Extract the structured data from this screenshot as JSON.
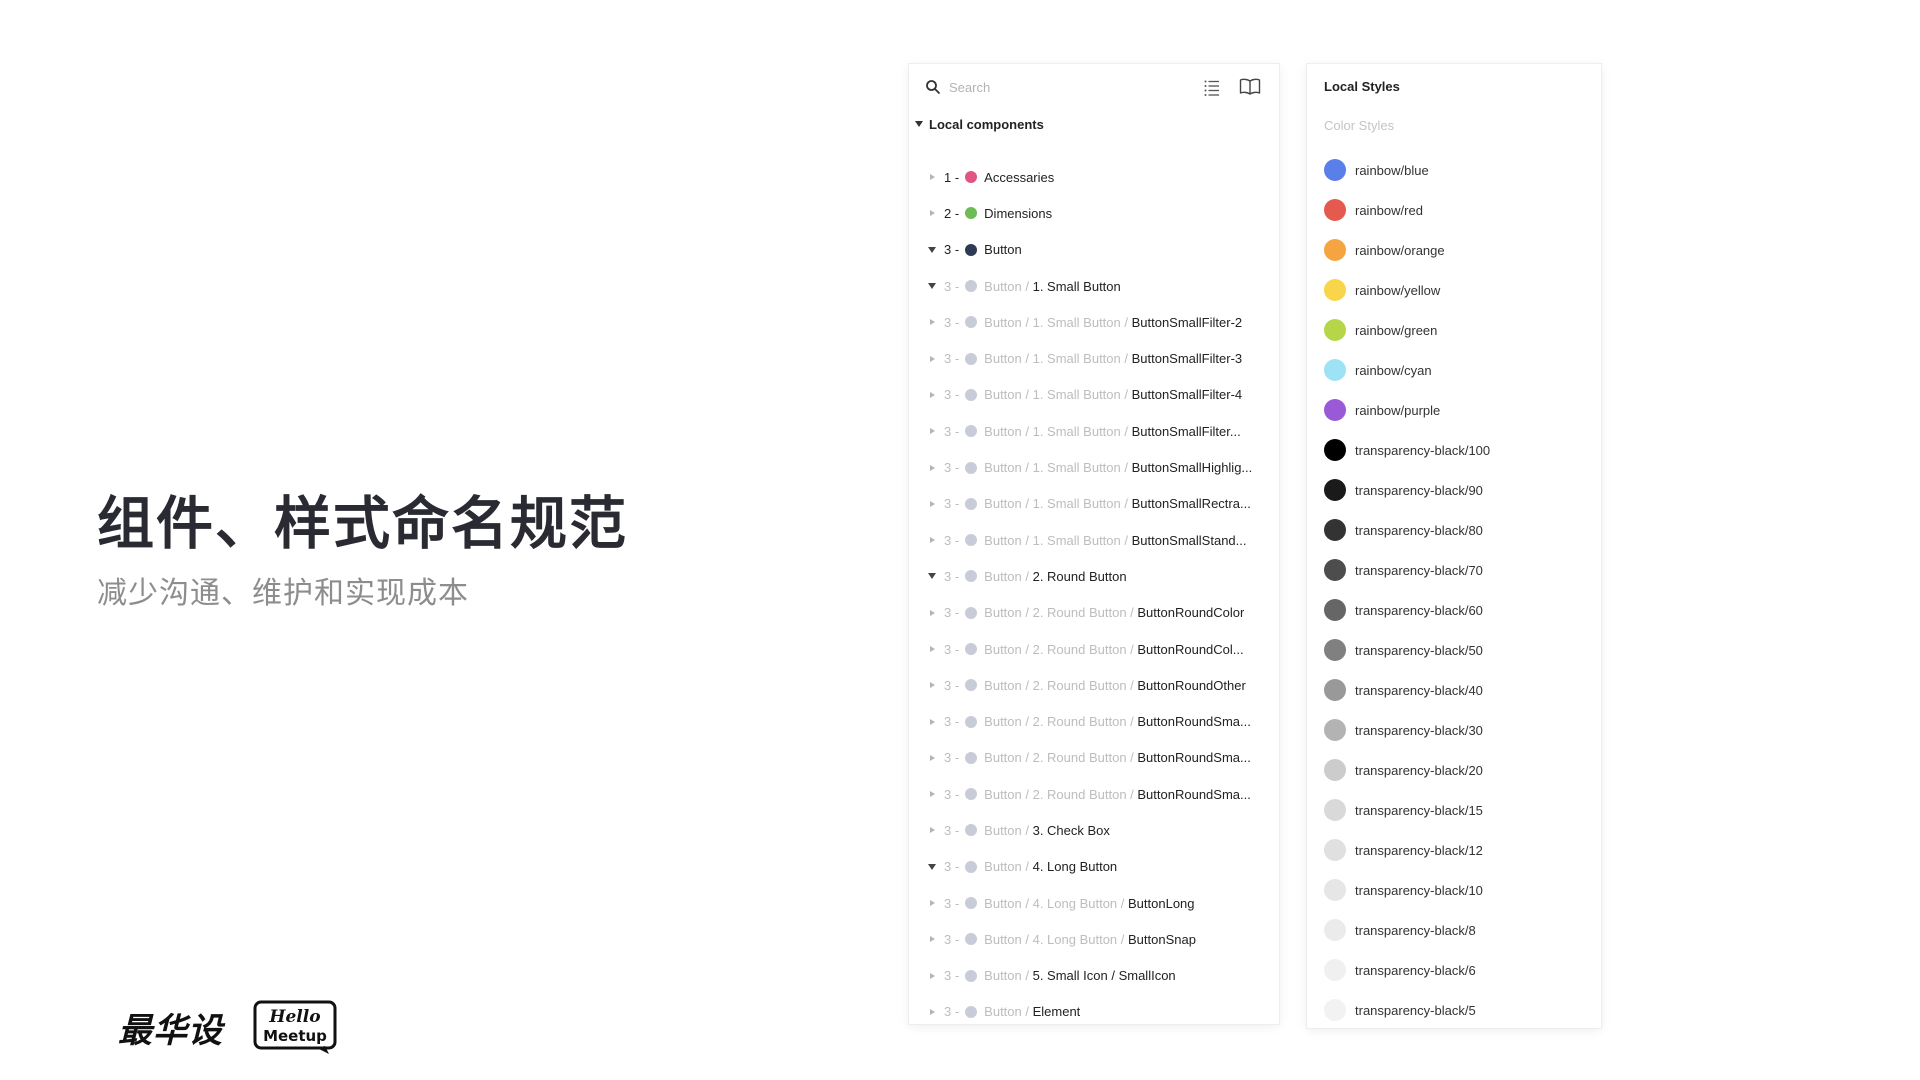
{
  "slide": {
    "title": "组件、样式命名规范",
    "subtitle": "减少沟通、维护和实现成本",
    "logo1": "最华设",
    "logo2_line1": "Hello",
    "logo2_line2": "Meetup"
  },
  "components_panel": {
    "search_placeholder": "Search",
    "section_label": "Local components",
    "rows": [
      {
        "expanded": false,
        "faded": true,
        "num": "1 -",
        "dot": "#e05585",
        "prefix": "",
        "name": "Accessaries",
        "fadeNum": false
      },
      {
        "expanded": false,
        "faded": true,
        "num": "2 -",
        "dot": "#6cbb55",
        "prefix": "",
        "name": "Dimensions",
        "fadeNum": false
      },
      {
        "expanded": true,
        "faded": true,
        "num": "3 -",
        "dot": "#2e3a55",
        "prefix": "",
        "name": "Button",
        "fadeNum": false
      },
      {
        "expanded": true,
        "faded": true,
        "num": "3 -",
        "dot": "#c8ccd8",
        "prefix": "Button / ",
        "name": "1. Small Button",
        "fadeNum": true
      },
      {
        "expanded": false,
        "faded": true,
        "num": "3 -",
        "dot": "#c8ccd8",
        "prefix": "Button / 1. Small Button / ",
        "name": "ButtonSmallFilter-2",
        "fadeNum": true
      },
      {
        "expanded": false,
        "faded": true,
        "num": "3 -",
        "dot": "#c8ccd8",
        "prefix": "Button / 1. Small Button / ",
        "name": "ButtonSmallFilter-3",
        "fadeNum": true
      },
      {
        "expanded": false,
        "faded": true,
        "num": "3 -",
        "dot": "#c8ccd8",
        "prefix": "Button / 1. Small Button / ",
        "name": "ButtonSmallFilter-4",
        "fadeNum": true
      },
      {
        "expanded": false,
        "faded": true,
        "num": "3 -",
        "dot": "#c8ccd8",
        "prefix": "Button / 1. Small Button / ",
        "name": "ButtonSmallFilter...",
        "fadeNum": true
      },
      {
        "expanded": false,
        "faded": true,
        "num": "3 -",
        "dot": "#c8ccd8",
        "prefix": "Button / 1. Small Button / ",
        "name": "ButtonSmallHighlig...",
        "fadeNum": true
      },
      {
        "expanded": false,
        "faded": true,
        "num": "3 -",
        "dot": "#c8ccd8",
        "prefix": "Button / 1. Small Button / ",
        "name": "ButtonSmallRectra...",
        "fadeNum": true
      },
      {
        "expanded": false,
        "faded": true,
        "num": "3 -",
        "dot": "#c8ccd8",
        "prefix": "Button / 1. Small Button / ",
        "name": "ButtonSmallStand...",
        "fadeNum": true
      },
      {
        "expanded": true,
        "faded": true,
        "num": "3 -",
        "dot": "#c8ccd8",
        "prefix": "Button / ",
        "name": "2. Round Button",
        "fadeNum": true
      },
      {
        "expanded": false,
        "faded": true,
        "num": "3 -",
        "dot": "#c8ccd8",
        "prefix": "Button / 2. Round Button / ",
        "name": "ButtonRoundColor",
        "fadeNum": true
      },
      {
        "expanded": false,
        "faded": true,
        "num": "3 -",
        "dot": "#c8ccd8",
        "prefix": "Button / 2. Round Button / ",
        "name": "ButtonRoundCol...",
        "fadeNum": true
      },
      {
        "expanded": false,
        "faded": true,
        "num": "3 -",
        "dot": "#c8ccd8",
        "prefix": "Button / 2. Round Button / ",
        "name": "ButtonRoundOther",
        "fadeNum": true
      },
      {
        "expanded": false,
        "faded": true,
        "num": "3 -",
        "dot": "#c8ccd8",
        "prefix": "Button / 2. Round Button / ",
        "name": "ButtonRoundSma...",
        "fadeNum": true
      },
      {
        "expanded": false,
        "faded": true,
        "num": "3 -",
        "dot": "#c8ccd8",
        "prefix": "Button / 2. Round Button / ",
        "name": "ButtonRoundSma...",
        "fadeNum": true
      },
      {
        "expanded": false,
        "faded": true,
        "num": "3 -",
        "dot": "#c8ccd8",
        "prefix": "Button / 2. Round Button / ",
        "name": "ButtonRoundSma...",
        "fadeNum": true
      },
      {
        "expanded": false,
        "faded": true,
        "num": "3 -",
        "dot": "#c8ccd8",
        "prefix": "Button / ",
        "name": "3. Check Box",
        "fadeNum": true
      },
      {
        "expanded": true,
        "faded": true,
        "num": "3 -",
        "dot": "#c8ccd8",
        "prefix": "Button / ",
        "name": "4. Long Button",
        "fadeNum": true
      },
      {
        "expanded": false,
        "faded": true,
        "num": "3 -",
        "dot": "#c8ccd8",
        "prefix": "Button / 4. Long Button / ",
        "name": "ButtonLong",
        "fadeNum": true
      },
      {
        "expanded": false,
        "faded": true,
        "num": "3 -",
        "dot": "#c8ccd8",
        "prefix": "Button / 4. Long Button / ",
        "name": "ButtonSnap",
        "fadeNum": true
      },
      {
        "expanded": false,
        "faded": true,
        "num": "3 -",
        "dot": "#c8ccd8",
        "prefix": "Button / ",
        "name": "5. Small Icon / SmallIcon",
        "fadeNum": true
      },
      {
        "expanded": false,
        "faded": true,
        "num": "3 -",
        "dot": "#c8ccd8",
        "prefix": "Button / ",
        "name": "Element",
        "fadeNum": true
      }
    ]
  },
  "styles_panel": {
    "title": "Local Styles",
    "subtitle": "Color Styles",
    "colors": [
      {
        "name": "rainbow/blue",
        "color": "#5b7fe8"
      },
      {
        "name": "rainbow/red",
        "color": "#e55a4e"
      },
      {
        "name": "rainbow/orange",
        "color": "#f4a541"
      },
      {
        "name": "rainbow/yellow",
        "color": "#f8d549"
      },
      {
        "name": "rainbow/green",
        "color": "#b6d64a"
      },
      {
        "name": "rainbow/cyan",
        "color": "#9ee3f5"
      },
      {
        "name": "rainbow/purple",
        "color": "#9a5ad8"
      },
      {
        "name": "transparency-black/100",
        "color": "#000000"
      },
      {
        "name": "transparency-black/90",
        "color": "#1a1a1a"
      },
      {
        "name": "transparency-black/80",
        "color": "#333333"
      },
      {
        "name": "transparency-black/70",
        "color": "#4d4d4d"
      },
      {
        "name": "transparency-black/60",
        "color": "#666666"
      },
      {
        "name": "transparency-black/50",
        "color": "#808080"
      },
      {
        "name": "transparency-black/40",
        "color": "#999999"
      },
      {
        "name": "transparency-black/30",
        "color": "#b3b3b3"
      },
      {
        "name": "transparency-black/20",
        "color": "#cccccc"
      },
      {
        "name": "transparency-black/15",
        "color": "#d9d9d9"
      },
      {
        "name": "transparency-black/12",
        "color": "#e0e0e0"
      },
      {
        "name": "transparency-black/10",
        "color": "#e6e6e6"
      },
      {
        "name": "transparency-black/8",
        "color": "#ebebeb"
      },
      {
        "name": "transparency-black/6",
        "color": "#f0f0f0"
      },
      {
        "name": "transparency-black/5",
        "color": "#f2f2f2"
      }
    ]
  }
}
